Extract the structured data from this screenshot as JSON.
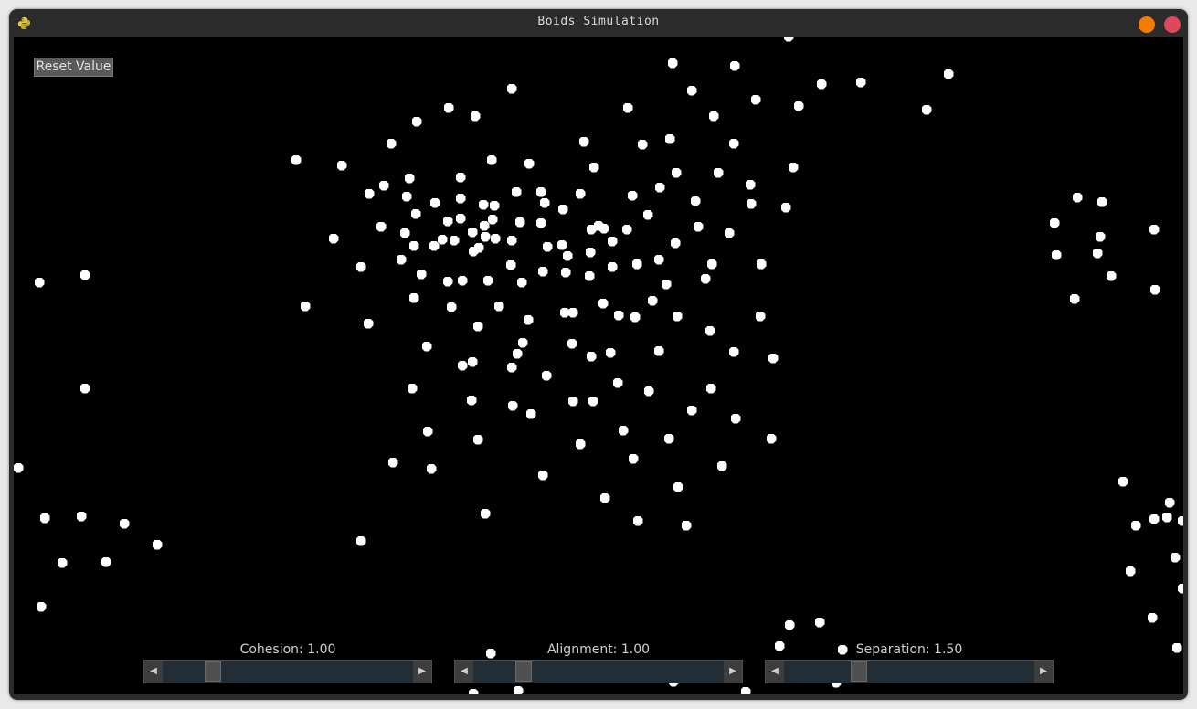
{
  "window": {
    "title": "Boids Simulation",
    "icon": "python-icon"
  },
  "controls": {
    "reset_label": "Reset Value",
    "sliders": [
      {
        "id": "cohesion",
        "label": "Cohesion: 1.00",
        "value": 1.0,
        "fraction": 0.2
      },
      {
        "id": "alignment",
        "label": "Alignment: 1.00",
        "value": 1.0,
        "fraction": 0.2
      },
      {
        "id": "separation",
        "label": "Separation: 1.50",
        "value": 1.5,
        "fraction": 0.3
      }
    ]
  },
  "colors": {
    "background": "#000000",
    "boid": "#ffffff",
    "minimize": "#f57c00",
    "close": "#e0475c"
  }
}
